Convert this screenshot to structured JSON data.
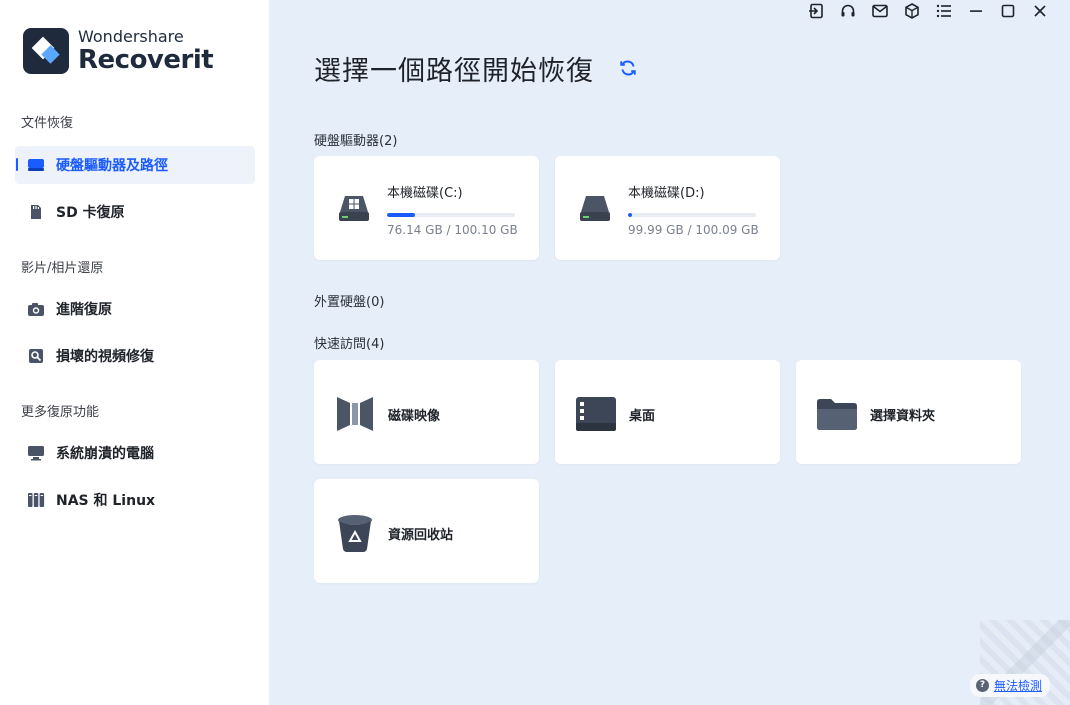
{
  "brand": {
    "top": "Wondershare",
    "name": "Recoverit"
  },
  "sidebar": {
    "sections": [
      {
        "title": "文件恢復"
      },
      {
        "title": "影片/相片還原"
      },
      {
        "title": "更多復原功能"
      }
    ],
    "items": [
      {
        "label": "硬盤驅動器及路徑",
        "icon": "hard-drive-icon",
        "active": true
      },
      {
        "label": "SD 卡復原",
        "icon": "sd-card-icon"
      },
      {
        "label": "進階復原",
        "icon": "camera-icon"
      },
      {
        "label": "損壞的視頻修復",
        "icon": "video-repair-icon"
      },
      {
        "label": "系統崩潰的電腦",
        "icon": "monitor-icon"
      },
      {
        "label": "NAS 和 Linux",
        "icon": "nas-icon"
      }
    ]
  },
  "window_controls": [
    "sign-in-icon",
    "headset-icon",
    "mail-icon",
    "cube-icon",
    "menu-icon",
    "minimize-icon",
    "maximize-icon",
    "close-icon"
  ],
  "main": {
    "title": "選擇一個路徑開始恢復",
    "groups": {
      "hard_drives": "硬盤驅動器(2)",
      "external": "外置硬盤(0)",
      "quick_access": "快速訪問(4)"
    },
    "drives": [
      {
        "name": "本機磁碟(C:)",
        "size": "76.14 GB / 100.10 GB",
        "used_fraction": 0.22,
        "windows_logo": true
      },
      {
        "name": "本機磁碟(D:)",
        "size": "99.99 GB / 100.09 GB",
        "used_fraction": 0.03,
        "windows_logo": false
      }
    ],
    "quick_access": [
      {
        "label": "磁碟映像",
        "icon": "disk-image-icon"
      },
      {
        "label": "桌面",
        "icon": "desktop-icon"
      },
      {
        "label": "選擇資料夾",
        "icon": "folder-icon"
      },
      {
        "label": "資源回收站",
        "icon": "recycle-bin-icon"
      }
    ],
    "help_link": "無法檢測"
  },
  "colors": {
    "accent": "#1a5cff",
    "main_bg": "#e6eef9",
    "card_bg": "#ffffff",
    "icon_dark": "#3c4656"
  }
}
